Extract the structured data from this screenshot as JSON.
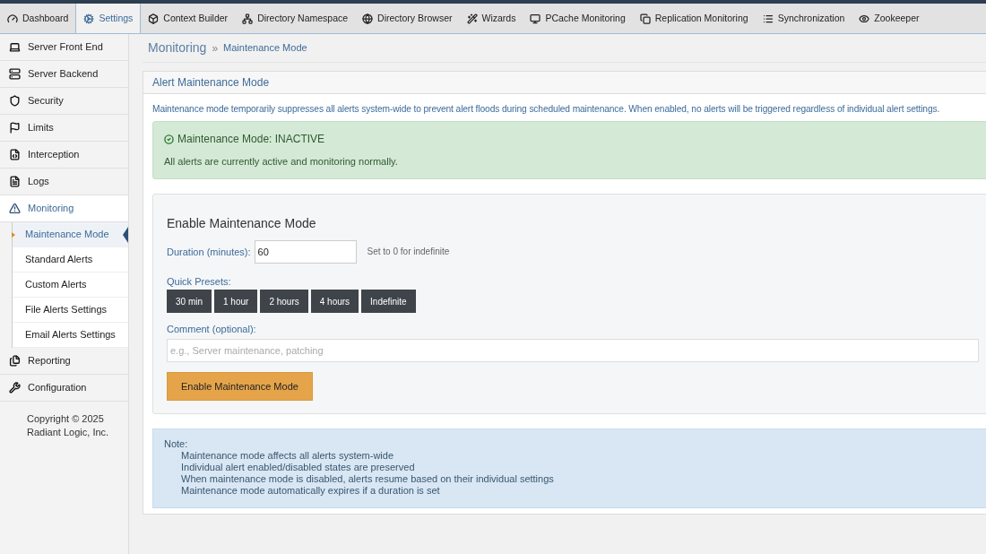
{
  "tabs": [
    {
      "label": "Dashboard",
      "selected": false
    },
    {
      "label": "Settings",
      "selected": true
    },
    {
      "label": "Context Builder",
      "selected": false
    },
    {
      "label": "Directory Namespace",
      "selected": false
    },
    {
      "label": "Directory Browser",
      "selected": false
    },
    {
      "label": "Wizards",
      "selected": false
    },
    {
      "label": "PCache Monitoring",
      "selected": false
    },
    {
      "label": "Replication Monitoring",
      "selected": false
    },
    {
      "label": "Synchronization",
      "selected": false
    },
    {
      "label": "Zookeeper",
      "selected": false
    }
  ],
  "sidebar": {
    "items": [
      {
        "label": "Server Front End",
        "selected": false
      },
      {
        "label": "Server Backend",
        "selected": false
      },
      {
        "label": "Security",
        "selected": false
      },
      {
        "label": "Limits",
        "selected": false
      },
      {
        "label": "Interception",
        "selected": false
      },
      {
        "label": "Logs",
        "selected": false
      },
      {
        "label": "Monitoring",
        "selected": true,
        "expanded": true,
        "children": [
          {
            "label": "Maintenance Mode",
            "selected": true
          },
          {
            "label": "Standard Alerts",
            "selected": false
          },
          {
            "label": "Custom Alerts",
            "selected": false
          },
          {
            "label": "File Alerts Settings",
            "selected": false
          },
          {
            "label": "Email Alerts Settings",
            "selected": false
          }
        ]
      },
      {
        "label": "Reporting",
        "selected": false
      },
      {
        "label": "Configuration",
        "selected": false
      }
    ],
    "copyright": [
      "Copyright © 2025",
      "Radiant Logic, Inc."
    ]
  },
  "breadcrumb": {
    "section": "Monitoring",
    "separator": "»",
    "page": "Maintenance Mode"
  },
  "panel": {
    "title": "Alert Maintenance Mode",
    "description": "Maintenance mode temporarily suppresses all alerts system-wide to prevent alert floods during scheduled maintenance. When enabled, no alerts will be triggered regardless of individual alert settings.",
    "status": {
      "title": "Maintenance Mode: INACTIVE",
      "message": "All alerts are currently active and monitoring normally."
    },
    "form": {
      "title": "Enable Maintenance Mode",
      "duration_label": "Duration (minutes):",
      "duration_value": "60",
      "duration_hint": "Set to 0 for indefinite",
      "presets_label": "Quick Presets:",
      "presets": [
        "30 min",
        "1 hour",
        "2 hours",
        "4 hours",
        "Indefinite"
      ],
      "comment_label": "Comment (optional):",
      "comment_placeholder": "e.g., Server maintenance, patching",
      "submit": "Enable Maintenance Mode"
    },
    "note": {
      "title": "Note:",
      "lines": [
        "Maintenance mode affects all alerts system-wide",
        "Individual alert enabled/disabled states are preserved",
        "When maintenance mode is disabled, alerts resume based on their individual settings",
        "Maintenance mode automatically expires if a duration is set"
      ]
    }
  }
}
